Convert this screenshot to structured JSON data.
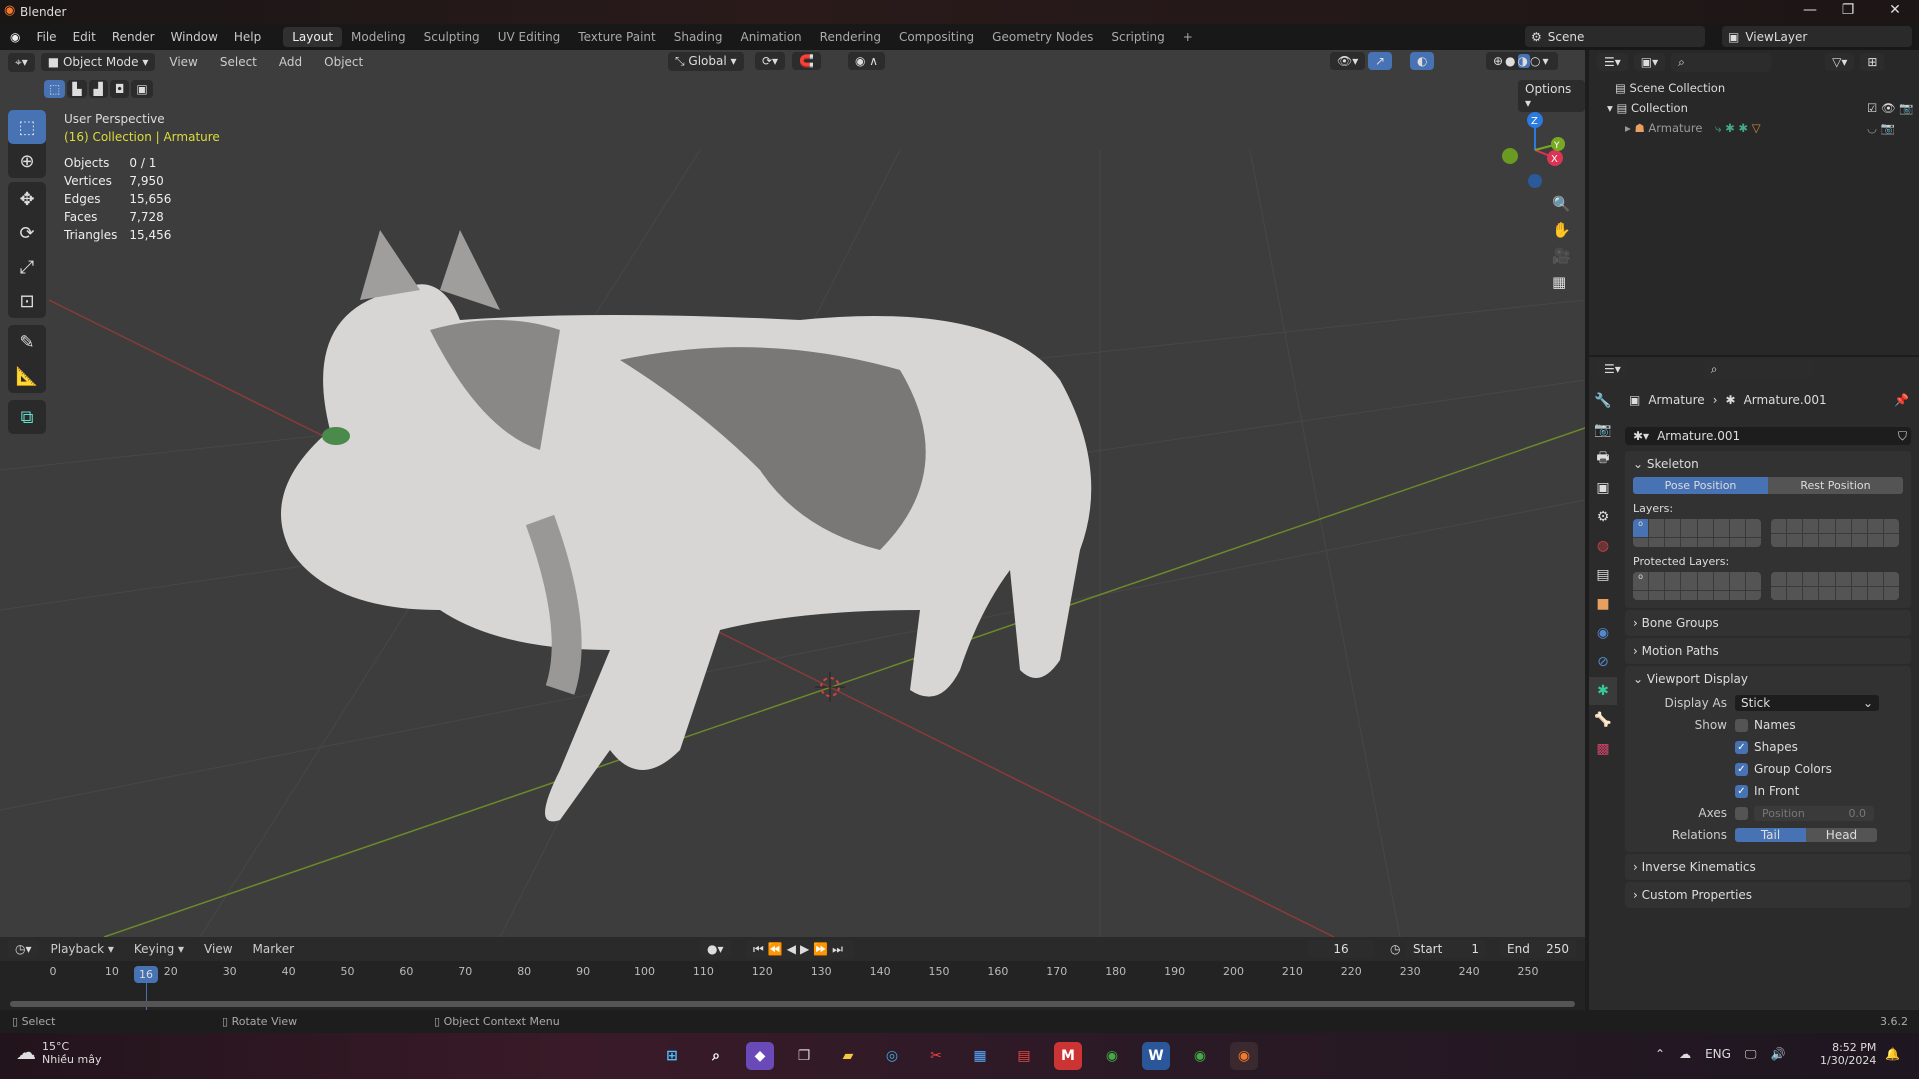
{
  "window": {
    "title": "Blender",
    "minimize": "—",
    "maximize": "❐",
    "close": "✕"
  },
  "menu": [
    "File",
    "Edit",
    "Render",
    "Window",
    "Help"
  ],
  "workspaces": [
    "Layout",
    "Modeling",
    "Sculpting",
    "UV Editing",
    "Texture Paint",
    "Shading",
    "Animation",
    "Rendering",
    "Compositing",
    "Geometry Nodes",
    "Scripting",
    "+"
  ],
  "scene": {
    "label": "Scene",
    "view_layer": "ViewLayer"
  },
  "viewport": {
    "mode": "Object Mode",
    "menus": [
      "View",
      "Select",
      "Add",
      "Object"
    ],
    "orientation": "Global",
    "options": "Options",
    "overlay_title": "User Perspective",
    "overlay_context": "(16) Collection | Armature",
    "stats": [
      [
        "Objects",
        "0 / 1"
      ],
      [
        "Vertices",
        "7,950"
      ],
      [
        "Edges",
        "15,656"
      ],
      [
        "Faces",
        "7,728"
      ],
      [
        "Triangles",
        "15,456"
      ]
    ],
    "gizmo": {
      "z": "Z",
      "x": "X",
      "y": "Y"
    }
  },
  "outliner": {
    "scene_collection": "Scene Collection",
    "collection": "Collection",
    "armature": "Armature"
  },
  "properties": {
    "breadcrumb_object": "Armature",
    "breadcrumb_data": "Armature.001",
    "data_name": "Armature.001",
    "skeleton": "Skeleton",
    "pose_position": "Pose Position",
    "rest_position": "Rest Position",
    "layers": "Layers:",
    "protected_layers": "Protected Layers:",
    "bone_groups": "Bone Groups",
    "motion_paths": "Motion Paths",
    "viewport_display": "Viewport Display",
    "display_as_label": "Display As",
    "display_as": "Stick",
    "show_label": "Show",
    "show": [
      {
        "label": "Names",
        "checked": false
      },
      {
        "label": "Shapes",
        "checked": true
      },
      {
        "label": "Group Colors",
        "checked": true
      },
      {
        "label": "In Front",
        "checked": true
      }
    ],
    "axes_label": "Axes",
    "axes_position": "Position",
    "axes_value": "0.0",
    "relations_label": "Relations",
    "tail": "Tail",
    "head": "Head",
    "inverse_kinematics": "Inverse Kinematics",
    "custom_properties": "Custom Properties"
  },
  "timeline": {
    "menus": [
      "Playback",
      "Keying",
      "View",
      "Marker"
    ],
    "current_frame": "16",
    "start_label": "Start",
    "start": "1",
    "end_label": "End",
    "end": "250",
    "ticks": [
      "0",
      "10",
      "20",
      "30",
      "40",
      "50",
      "60",
      "70",
      "80",
      "90",
      "100",
      "110",
      "120",
      "130",
      "140",
      "150",
      "160",
      "170",
      "180",
      "190",
      "200",
      "210",
      "220",
      "230",
      "240",
      "250"
    ]
  },
  "status": {
    "select": "Select",
    "rotate": "Rotate View",
    "context": "Object Context Menu",
    "version": "3.6.2"
  },
  "taskbar": {
    "temp": "15°C",
    "weather": "Nhiều mây",
    "lang": "ENG",
    "time": "8:52 PM",
    "date": "1/30/2024"
  }
}
